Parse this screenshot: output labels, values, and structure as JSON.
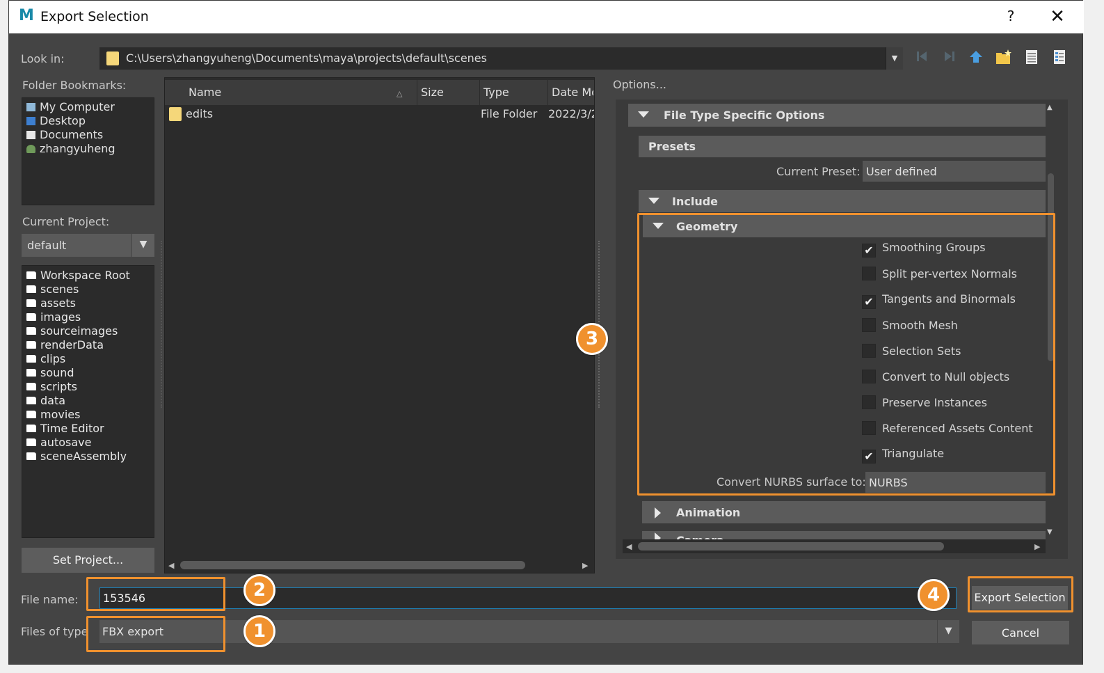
{
  "window": {
    "title": "Export Selection",
    "help": "?",
    "close": "✕"
  },
  "look_in": {
    "label": "Look in:",
    "path": "C:\\Users\\zhangyuheng\\Documents\\maya\\projects\\default\\scenes"
  },
  "toolbar_icons": [
    "back-icon",
    "forward-icon",
    "up-folder-icon",
    "new-folder-icon",
    "list-view-icon",
    "detail-view-icon"
  ],
  "bookmarks": {
    "label": "Folder Bookmarks:",
    "items": [
      "My Computer",
      "Desktop",
      "Documents",
      "zhangyuheng"
    ]
  },
  "project": {
    "label": "Current Project:",
    "value": "default",
    "set_button": "Set Project..."
  },
  "folders": [
    "Workspace Root",
    "scenes",
    "assets",
    "images",
    "sourceimages",
    "renderData",
    "clips",
    "sound",
    "scripts",
    "data",
    "movies",
    "Time Editor",
    "autosave",
    "sceneAssembly"
  ],
  "files": {
    "columns": [
      "Name",
      "Size",
      "Type",
      "Date Mo"
    ],
    "rows": [
      {
        "name": "edits",
        "size": "",
        "type": "File Folder",
        "date": "2022/3/2"
      }
    ]
  },
  "options": {
    "label": "Options...",
    "file_type_section": "File Type Specific Options",
    "presets_section": "Presets",
    "current_preset_label": "Current Preset:",
    "current_preset_value": "User defined",
    "include_section": "Include",
    "geometry_section": "Geometry",
    "checkboxes": [
      {
        "label": "Smoothing Groups",
        "checked": true
      },
      {
        "label": "Split per-vertex Normals",
        "checked": false
      },
      {
        "label": "Tangents and Binormals",
        "checked": true
      },
      {
        "label": "Smooth Mesh",
        "checked": false
      },
      {
        "label": "Selection Sets",
        "checked": false
      },
      {
        "label": "Convert to Null objects",
        "checked": false
      },
      {
        "label": "Preserve Instances",
        "checked": false
      },
      {
        "label": "Referenced Assets Content",
        "checked": false
      },
      {
        "label": "Triangulate",
        "checked": true
      }
    ],
    "nurbs_label": "Convert NURBS surface to:",
    "nurbs_value": "NURBS",
    "animation_section": "Animation",
    "camera_section": "Camera"
  },
  "file_name": {
    "label": "File name:",
    "value": "153546"
  },
  "file_type": {
    "label": "Files of type",
    "value": "FBX export"
  },
  "buttons": {
    "export": "Export Selection",
    "cancel": "Cancel"
  },
  "badges": [
    "1",
    "2",
    "3",
    "4"
  ],
  "colors": {
    "accent": "#f0912e",
    "panel_dark": "#2b2b2b",
    "window_bg": "#444444",
    "focus_border": "#1e80b6"
  }
}
